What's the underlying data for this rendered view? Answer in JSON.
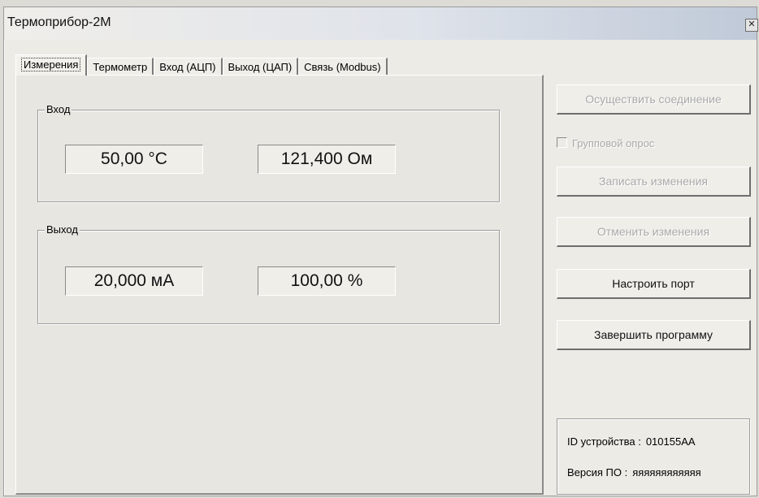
{
  "window": {
    "title": "Термоприбор-2М",
    "close_glyph": "✕"
  },
  "tabs": [
    {
      "label": "Измерения",
      "active": true
    },
    {
      "label": "Термометр",
      "active": false
    },
    {
      "label": "Вход (АЦП)",
      "active": false
    },
    {
      "label": "Выход (ЦАП)",
      "active": false
    },
    {
      "label": "Связь (Modbus)",
      "active": false
    }
  ],
  "input_group": {
    "label": "Вход",
    "temperature": "50,00 °С",
    "resistance": "121,400 Ом"
  },
  "output_group": {
    "label": "Выход",
    "current": "20,000 мА",
    "percent": "100,00 %"
  },
  "side_panel": {
    "connect_button": "Осуществить соединение",
    "group_poll_label": "Групповой опрос",
    "write_button": "Записать изменения",
    "cancel_button": "Отменить изменения",
    "port_button": "Настроить порт",
    "exit_button": "Завершить программу"
  },
  "device_info": {
    "id_label": "ID устройства :",
    "id_value": "010155AA",
    "fw_label": "Версия ПО :",
    "fw_value": "яяяяяяяяяяяя"
  }
}
